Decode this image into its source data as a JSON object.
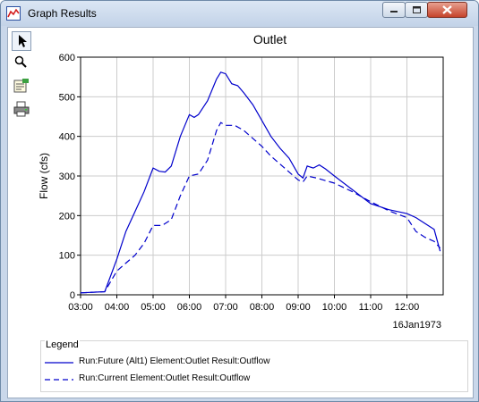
{
  "window": {
    "title": "Graph Results"
  },
  "toolbar": {
    "tools": [
      "select-arrow-icon",
      "zoom-icon",
      "properties-icon",
      "print-icon"
    ]
  },
  "colors": {
    "accent": "#0000cc",
    "grid": "#cccccc",
    "axis": "#000000"
  },
  "chart_data": {
    "type": "line",
    "title": "Outlet",
    "xlabel": "",
    "ylabel": "Flow (cfs)",
    "date_label": "16Jan1973",
    "x_ticks": [
      "03:00",
      "04:00",
      "05:00",
      "06:00",
      "07:00",
      "08:00",
      "09:00",
      "10:00",
      "11:00",
      "12:00"
    ],
    "y_ticks": [
      "0",
      "100",
      "200",
      "300",
      "400",
      "500",
      "600"
    ],
    "xlim": [
      "03:00",
      "13:00"
    ],
    "ylim": [
      0,
      600
    ],
    "grid": true,
    "legend_position": "bottom",
    "series": [
      {
        "name": "Run:Future (Alt1) Element:Outlet Result:Outflow",
        "style": "solid",
        "points": [
          [
            "03:00",
            5
          ],
          [
            "03:40",
            8
          ],
          [
            "04:00",
            90
          ],
          [
            "04:15",
            160
          ],
          [
            "04:30",
            210
          ],
          [
            "04:45",
            260
          ],
          [
            "05:00",
            320
          ],
          [
            "05:10",
            312
          ],
          [
            "05:20",
            310
          ],
          [
            "05:30",
            325
          ],
          [
            "05:45",
            400
          ],
          [
            "06:00",
            455
          ],
          [
            "06:08",
            448
          ],
          [
            "06:15",
            455
          ],
          [
            "06:30",
            490
          ],
          [
            "06:45",
            545
          ],
          [
            "06:52",
            562
          ],
          [
            "07:00",
            558
          ],
          [
            "07:10",
            533
          ],
          [
            "07:20",
            528
          ],
          [
            "07:30",
            510
          ],
          [
            "07:45",
            480
          ],
          [
            "08:00",
            440
          ],
          [
            "08:15",
            400
          ],
          [
            "08:30",
            370
          ],
          [
            "08:45",
            345
          ],
          [
            "09:00",
            305
          ],
          [
            "09:08",
            295
          ],
          [
            "09:15",
            325
          ],
          [
            "09:25",
            320
          ],
          [
            "09:35",
            328
          ],
          [
            "09:45",
            318
          ],
          [
            "10:00",
            300
          ],
          [
            "10:30",
            265
          ],
          [
            "11:00",
            230
          ],
          [
            "11:30",
            215
          ],
          [
            "12:00",
            205
          ],
          [
            "12:15",
            195
          ],
          [
            "12:30",
            180
          ],
          [
            "12:45",
            165
          ],
          [
            "12:55",
            110
          ]
        ]
      },
      {
        "name": "Run:Current Element:Outlet Result:Outflow",
        "style": "dashed",
        "points": [
          [
            "03:00",
            5
          ],
          [
            "03:40",
            8
          ],
          [
            "04:00",
            60
          ],
          [
            "04:15",
            80
          ],
          [
            "04:30",
            100
          ],
          [
            "04:45",
            130
          ],
          [
            "05:00",
            175
          ],
          [
            "05:15",
            175
          ],
          [
            "05:30",
            190
          ],
          [
            "05:45",
            250
          ],
          [
            "06:00",
            300
          ],
          [
            "06:15",
            305
          ],
          [
            "06:30",
            340
          ],
          [
            "06:45",
            415
          ],
          [
            "06:52",
            435
          ],
          [
            "07:00",
            428
          ],
          [
            "07:15",
            428
          ],
          [
            "07:30",
            415
          ],
          [
            "07:45",
            395
          ],
          [
            "08:00",
            375
          ],
          [
            "08:15",
            350
          ],
          [
            "08:30",
            330
          ],
          [
            "08:45",
            310
          ],
          [
            "09:00",
            290
          ],
          [
            "09:08",
            285
          ],
          [
            "09:15",
            300
          ],
          [
            "09:30",
            295
          ],
          [
            "10:00",
            282
          ],
          [
            "10:30",
            260
          ],
          [
            "11:00",
            235
          ],
          [
            "11:30",
            212
          ],
          [
            "12:00",
            195
          ],
          [
            "12:15",
            160
          ],
          [
            "12:30",
            145
          ],
          [
            "12:45",
            135
          ],
          [
            "12:55",
            118
          ]
        ]
      }
    ]
  }
}
